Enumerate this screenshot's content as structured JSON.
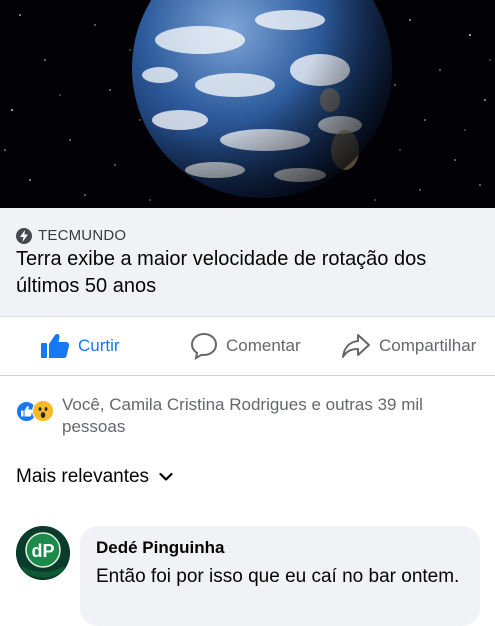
{
  "post": {
    "image": {
      "subject": "earth-from-space"
    },
    "link": {
      "source": "TECMUNDO",
      "headline": "Terra exibe a maior velocidade de rotação dos últimos 50 anos"
    },
    "actions": {
      "like_label": "Curtir",
      "comment_label": "Comentar",
      "share_label": "Compartilhar"
    },
    "reactions": {
      "summary": "Você, Camila Cristina Rodrigues e outras 39 mil pessoas",
      "icons": [
        "like-icon",
        "wow-icon"
      ]
    },
    "comments": {
      "sort_label": "Mais relevantes",
      "items": [
        {
          "author": "Dedé Pinguinha",
          "text": "Então foi por isso que eu caí no bar ontem."
        }
      ]
    }
  },
  "colors": {
    "accent": "#1877f2",
    "muted": "#65676b",
    "preview_bg": "#f0f2f5",
    "wow": "#f7b928"
  }
}
